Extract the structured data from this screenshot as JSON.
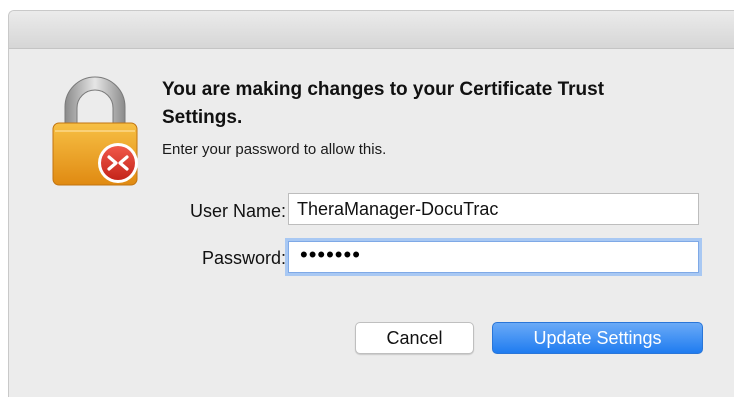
{
  "dialog": {
    "heading": "You are making changes to your Certificate Trust Settings.",
    "subtext": "Enter your password to allow this.",
    "icon": "lock-icon with remote-desktop badge",
    "accent_color": "#1f7cf0"
  },
  "form": {
    "username_label": "User Name:",
    "username_value": "TheraManager-DocuTrac",
    "password_label": "Password:",
    "password_masked": "•••••••"
  },
  "buttons": {
    "cancel_label": "Cancel",
    "update_label": "Update Settings"
  }
}
